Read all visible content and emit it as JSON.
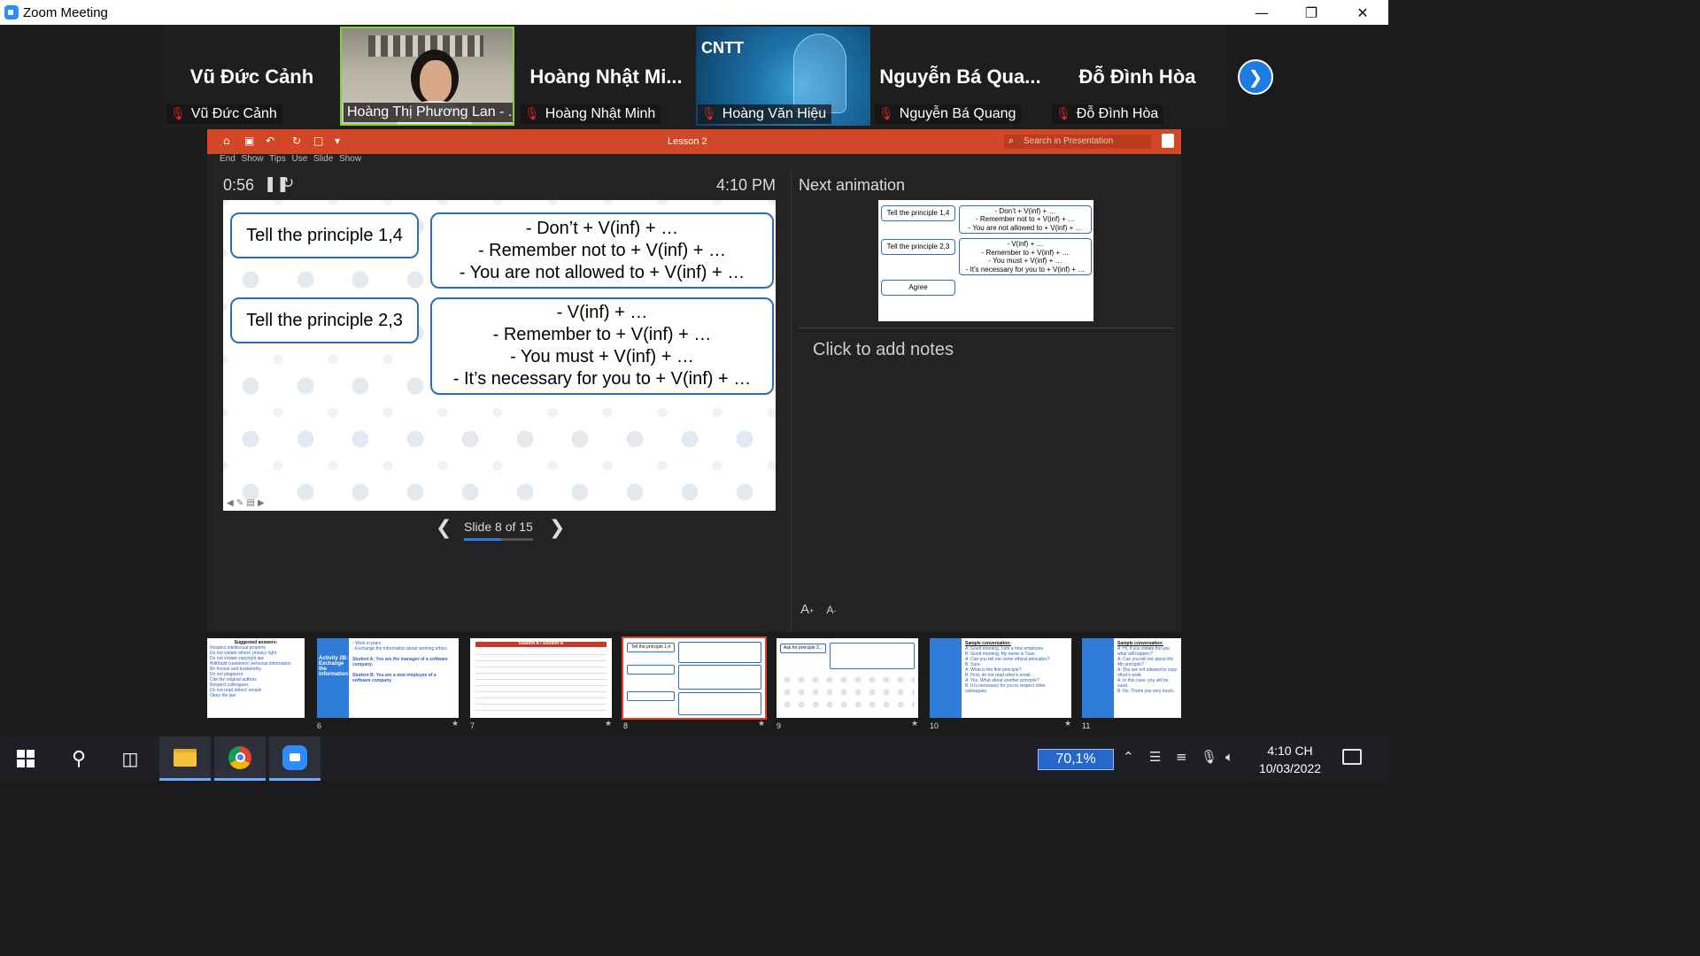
{
  "window": {
    "title": "Zoom Meeting"
  },
  "participants": [
    {
      "display": "Vũ Đức Cảnh",
      "label": "Vũ Đức Cảnh",
      "muted": true,
      "video": false
    },
    {
      "display": "",
      "label": "Hoàng Thị Phương Lan - ...",
      "muted": false,
      "video": true,
      "active": true
    },
    {
      "display": "Hoàng Nhật Mi...",
      "label": "Hoàng Nhật Minh",
      "muted": true,
      "video": false
    },
    {
      "display": "CNTT",
      "label": "Hoàng Văn Hiệu",
      "muted": true,
      "video": true
    },
    {
      "display": "Nguyễn Bá Qua...",
      "label": "Nguyễn Bá Quang",
      "muted": true,
      "video": false
    },
    {
      "display": "Đỗ Đình Hòa",
      "label": "Đỗ Đình Hòa",
      "muted": true,
      "video": false
    }
  ],
  "ribbon": {
    "doc_title": "Lesson 2",
    "search_placeholder": "Search in Presentation"
  },
  "presenter": {
    "menu": "End Show   Tips   Use Slide Show",
    "timer": "0:56",
    "clock": "4:10 PM",
    "next_animation_label": "Next animation",
    "notes_placeholder": "Click to add notes",
    "font_up": "A",
    "font_down": "A",
    "slide_counter": "Slide 8 of 15",
    "progress": 0.533
  },
  "slide": {
    "box1_title": "Tell the principle 1,4",
    "box1_lines": [
      "- Don’t + V(inf) + …",
      "-  Remember not to + V(inf) + …",
      "-  You are not allowed to + V(inf) + …"
    ],
    "box2_title": "Tell the principle 2,3",
    "box2_lines": [
      "- V(inf) + …",
      "-  Remember to + V(inf) + …",
      "-  You must + V(inf) + …",
      "-  It’s necessary for you to + V(inf) + …"
    ]
  },
  "next_thumb": {
    "t1": "Tell the principle 1,4",
    "l1": [
      "- Don’t + V(inf) + …",
      "- Remember not to + V(inf) + …",
      "- You are not allowed to + V(inf) + …"
    ],
    "t2": "Tell the principle 2,3",
    "l2": [
      "- V(inf) + …",
      "- Remember to + V(inf) + …",
      "- You must + V(inf) + …",
      "- It’s necessary for you to + V(inf) + …"
    ],
    "agree": "Agree"
  },
  "sorter": {
    "slides": [
      {
        "num": "",
        "title": "Suggested answers:"
      },
      {
        "num": "6",
        "title": "Activity 2B: Exchange the information"
      },
      {
        "num": "7",
        "title": "Student A / Student B"
      },
      {
        "num": "8",
        "title": "Tell the principle 1,4"
      },
      {
        "num": "9",
        "title": "Ask for principle 2..."
      },
      {
        "num": "10",
        "title": "Sample conversation:"
      },
      {
        "num": "11",
        "title": "Sample conversation:"
      }
    ]
  },
  "taskbar": {
    "zoom_percent": "70,1%",
    "time": "4:10 CH",
    "date": "10/03/2022"
  },
  "colors": {
    "ribbon": "#d24726",
    "accent": "#2d8cff",
    "active_border": "#7fd33c"
  }
}
